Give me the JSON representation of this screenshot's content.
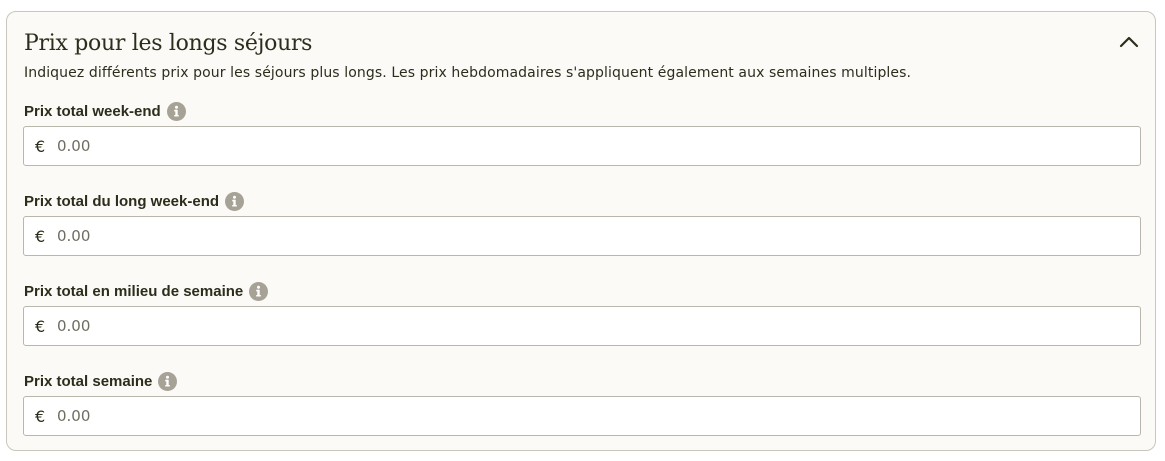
{
  "section": {
    "title": "Prix pour les longs séjours",
    "subtitle": "Indiquez différents prix pour les séjours plus longs. Les prix hebdomadaires s'appliquent également aux semaines multiples.",
    "collapse_icon": "chevron-up-icon"
  },
  "fields": [
    {
      "label": "Prix total week-end",
      "currency": "€",
      "placeholder": "0.00",
      "value": ""
    },
    {
      "label": "Prix total du long week-end",
      "currency": "€",
      "placeholder": "0.00",
      "value": ""
    },
    {
      "label": "Prix total en milieu de semaine",
      "currency": "€",
      "placeholder": "0.00",
      "value": ""
    },
    {
      "label": "Prix total semaine",
      "currency": "€",
      "placeholder": "0.00",
      "value": ""
    }
  ],
  "colors": {
    "text": "#2d2d1c",
    "info_icon": "#a7a296",
    "card_background": "#fbfaf6",
    "border": "#c9c6bc"
  }
}
